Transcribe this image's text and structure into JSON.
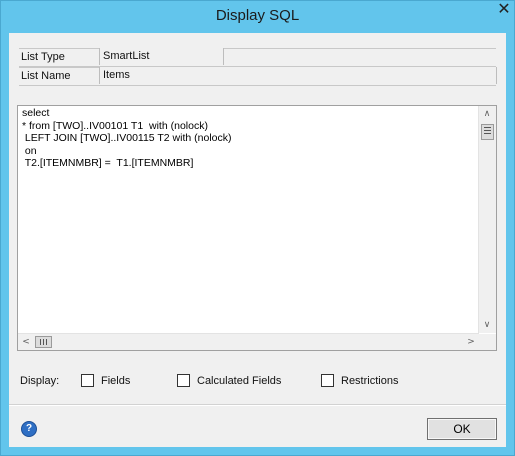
{
  "window": {
    "title": "Display SQL",
    "close_glyph": "✕"
  },
  "header": {
    "list_type_label": "List Type",
    "list_type_value": "SmartList",
    "list_name_label": "List Name",
    "list_name_value": "Items"
  },
  "sql": {
    "text": "select\n* from [TWO]..IV00101 T1  with (nolock)\n LEFT JOIN [TWO]..IV00115 T2 with (nolock)\n on\n T2.[ITEMNMBR] =  T1.[ITEMNMBR]"
  },
  "display": {
    "label": "Display:",
    "options": [
      {
        "label": "Fields",
        "checked": false
      },
      {
        "label": "Calculated Fields",
        "checked": false
      },
      {
        "label": "Restrictions",
        "checked": false
      }
    ]
  },
  "footer": {
    "help_icon": "help-icon",
    "help_glyph": "?",
    "ok_label": "OK"
  },
  "scroll": {
    "up_glyph": "∧",
    "down_glyph": "∨",
    "left_glyph": "<",
    "right_glyph": ">"
  }
}
